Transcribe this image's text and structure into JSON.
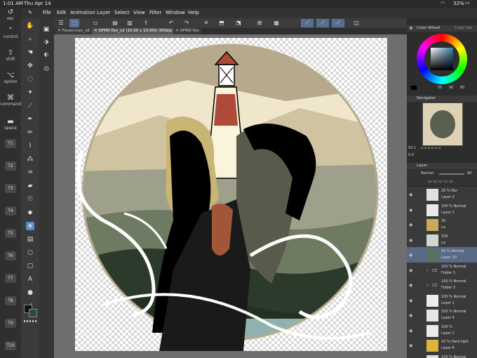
{
  "status": {
    "time": "1:01 AM",
    "date": "Thu Apr 14",
    "battery": "32%"
  },
  "menu": [
    "File",
    "Edit",
    "Animation",
    "Layer",
    "Select",
    "View",
    "Filter",
    "Window",
    "Help"
  ],
  "touch_panel": {
    "keys": [
      "esc",
      "control",
      "shift",
      "option",
      "command",
      "space"
    ],
    "fkeys": [
      "T1",
      "T2",
      "T3",
      "T4",
      "T5",
      "T6",
      "T7",
      "T8",
      "T9",
      "T10"
    ]
  },
  "tabs": [
    {
      "label": "Flowermes_v8"
    },
    {
      "label": "OFMD Fan_v2 (10.00 x 10.00in 300dpi 59.1%)"
    },
    {
      "label": "OFMD Fan"
    }
  ],
  "color_wheel": {
    "title": "Color Wheel",
    "tab2": "Color Set",
    "h": "55",
    "s": "90",
    "v": "80"
  },
  "navigator": {
    "title": "Navigator",
    "zoom": "59.1",
    "angle": "0.0"
  },
  "layer_panel": {
    "title": "Layer",
    "blend": "Normal",
    "opacity": "60",
    "layers": [
      {
        "mode": "25 %  Nor",
        "name": "Layer 2",
        "thumb": "#e0e0e0"
      },
      {
        "mode": "100 %  Normal",
        "name": "Layer 1",
        "thumb": "#e8e8e8"
      },
      {
        "mode": "25",
        "name": "La",
        "thumb": "#c9a95a"
      },
      {
        "mode": "100",
        "name": "La",
        "thumb": "#cfd6d0"
      },
      {
        "mode": "50 %  Normal",
        "name": "Layer 10",
        "thumb": "#58715c",
        "selected": true
      },
      {
        "mode": "100 %  Normal",
        "name": "Folder 1",
        "folder": true
      },
      {
        "mode": "100 %  Normal",
        "name": "Folder 2",
        "folder": true
      },
      {
        "mode": "100 %  Normal",
        "name": "Layer 1",
        "thumb": "#ececec"
      },
      {
        "mode": "100 %  Normal",
        "name": "Layer 4",
        "thumb": "#e6e6e6"
      },
      {
        "mode": "100 %",
        "name": "Layer 1",
        "thumb": "#eaeaea"
      },
      {
        "mode": "10 %  Hard light",
        "name": "Layer 6",
        "thumb": "#dcb43c"
      },
      {
        "mode": "100 %  Normal",
        "name": "",
        "thumb": "#ddd"
      }
    ]
  },
  "colors": {
    "accent": "#5a8ad0",
    "sel_layer": "#596a86"
  }
}
